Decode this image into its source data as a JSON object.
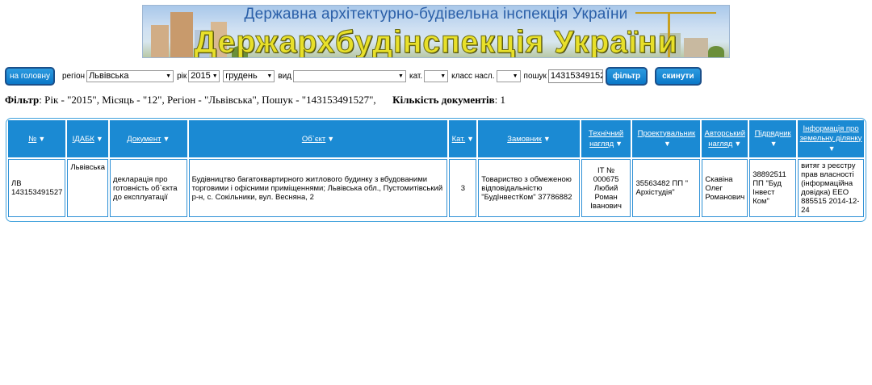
{
  "banner": {
    "top_text": "Державна архітектурно-будівельна інспекція України",
    "main_text": "Держархбудінспекція України"
  },
  "filter_bar": {
    "home_button": "на головну",
    "region_label": "регіон",
    "region_value": "Львівська",
    "year_label": "рік",
    "year_value": "2015",
    "month_value": "грудень",
    "type_label": "вид",
    "type_value": "",
    "cat_label": "кат.",
    "cat_value": "",
    "class_label": "класс насл.",
    "class_value": "",
    "search_label": "пошук",
    "search_value": "143153491527",
    "filter_button": "фільтр",
    "reset_button": "скинути"
  },
  "filter_summary": {
    "filter_label": "Фільтр",
    "filter_text": ": Рік - \"2015\", Місяць - \"12\", Регіон - \"Львівська\", Пошук - \"143153491527\",",
    "count_label": "Кількість документів",
    "count_value": ": 1"
  },
  "table": {
    "headers": [
      "№",
      "ІДАБК",
      "Документ",
      "Об`єкт",
      "Кат.",
      "Замовник",
      "Технічний нагляд",
      "Проектувальник",
      "Авторський нагляд",
      "Підрядник",
      "Інформація про земельну ділянку"
    ],
    "rows": [
      {
        "num": "ЛВ 143153491527",
        "idabk": "Львівська",
        "document": "декларація про готовність об`єкта до експлуатації",
        "object": "Будівництво багатоквартирного житлового будинку з вбудованими торговими і офісними приміщеннями; Львівська обл., Пустомитівський р-н, с. Сокільники, вул. Весняна, 2",
        "cat": "3",
        "customer": "Товариство з обмеженою відповідальністю \"БудІнвестКом\" 37786882",
        "tech_supervision": "ІТ № 000675 Любий Роман Іванович",
        "designer": "35563482 ПП \" Архістудія\"",
        "author_supervision": "Скавіна Олег Романович",
        "contractor": "38892511 ПП \"Буд Інвест Ком\"",
        "land_info": "витяг з реєстру прав власності (інформаційна довідка) ЕЕО 885515 2014-12-24"
      }
    ]
  }
}
